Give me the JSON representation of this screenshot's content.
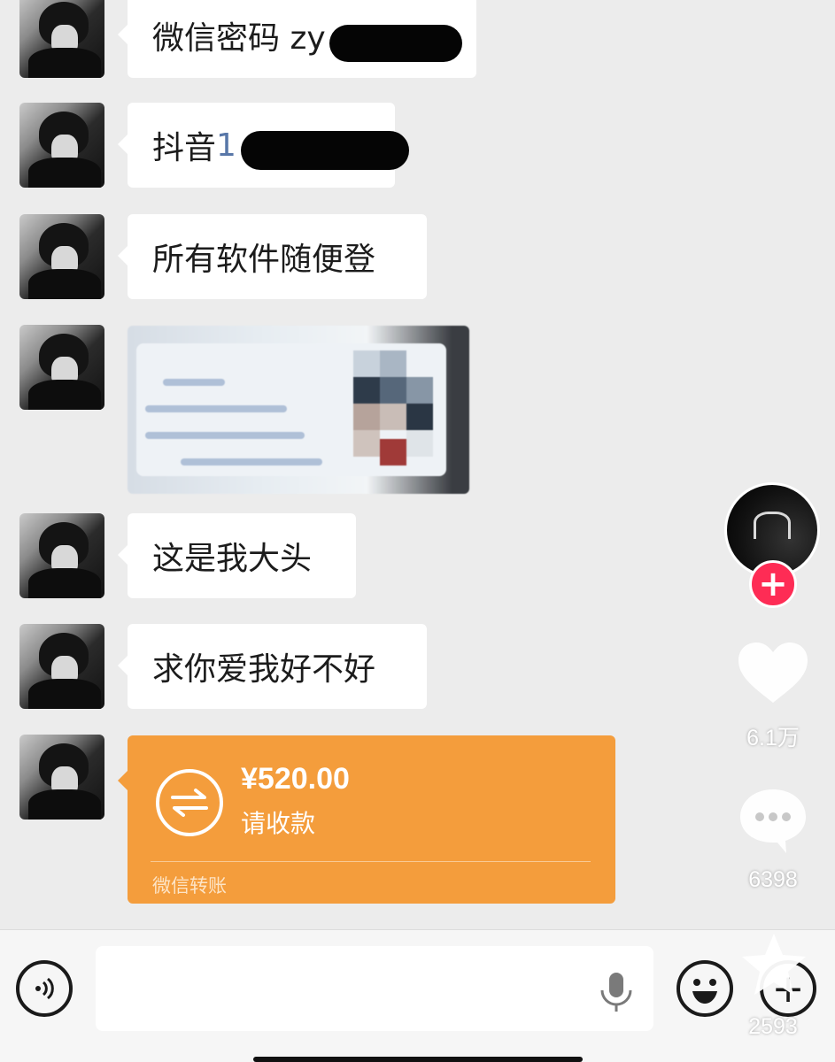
{
  "messages": [
    {
      "type": "text",
      "text": "微信密码 zy",
      "suffix": ""
    },
    {
      "type": "text",
      "text": "抖音 ",
      "suffix": "1"
    },
    {
      "type": "text",
      "text": "所有软件随便登",
      "suffix": ""
    },
    {
      "type": "image"
    },
    {
      "type": "text",
      "text": "这是我大头",
      "suffix": ""
    },
    {
      "type": "text",
      "text": "求你爱我好不好",
      "suffix": ""
    }
  ],
  "transfer": {
    "amount": "¥520.00",
    "status": "请收款",
    "footer": "微信转账",
    "icon": "transfer-arrows-icon",
    "color": "#f49d3c"
  },
  "side_actions": {
    "likes": "6.1万",
    "comments": "6398",
    "favorites": "2593",
    "follow_color": "#fe2c55"
  },
  "input_bar": {
    "voice_icon": "voice-icon",
    "mic_icon": "microphone-icon",
    "emoji_icon": "emoji-icon",
    "plus_icon": "plus-icon"
  }
}
